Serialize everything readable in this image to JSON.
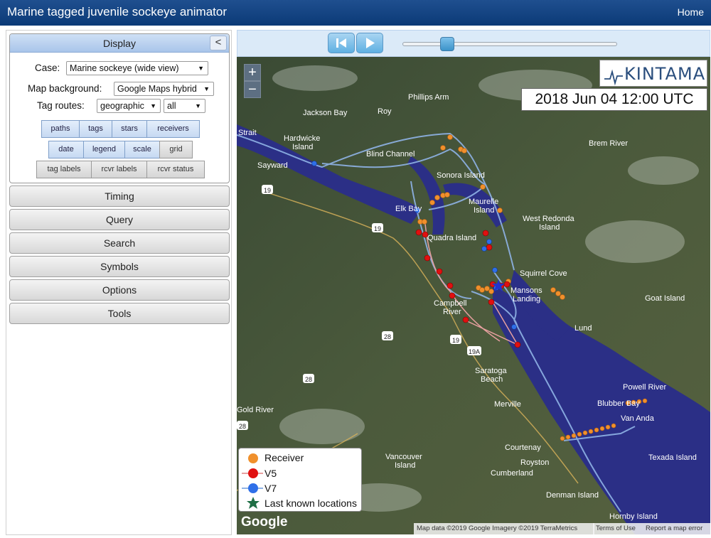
{
  "header": {
    "title": "Marine tagged juvenile sockeye animator",
    "home_label": "Home"
  },
  "display": {
    "title": "Display",
    "collapse_label": "<",
    "case_label": "Case:",
    "case_value": "Marine sockeye (wide view)",
    "map_bg_label": "Map background:",
    "map_bg_value": "Google Maps hybrid",
    "routes_label": "Tag routes:",
    "routes_value": "geographic",
    "routes_filter": "all",
    "toggles_row1": [
      "paths",
      "tags",
      "stars",
      "receivers"
    ],
    "toggles_row2": [
      "date",
      "legend",
      "scale",
      "grid"
    ],
    "toggles_row3": [
      "tag labels",
      "rcvr labels",
      "rcvr status"
    ]
  },
  "sections": [
    "Timing",
    "Query",
    "Search",
    "Symbols",
    "Options",
    "Tools"
  ],
  "playback": {
    "slider_fraction": 0.21
  },
  "map": {
    "zoom_in": "+",
    "zoom_out": "−",
    "logo": "KINTAMA",
    "date": "2018 Jun 04 12:00 UTC",
    "google": "Google",
    "attribution": [
      "Map data ©2019 Google Imagery ©2019 TerraMetrics",
      "Terms of Use",
      "Report a map error"
    ],
    "labels": [
      "Phillips Arm",
      "Jackson Bay",
      "Roy",
      "Hardwicke",
      "Island",
      "Blind Channel",
      "Sayward",
      "Sonora Island",
      "Brem River",
      "Maurelle",
      "Island",
      "Elk Bay",
      "West Redonda",
      "Island",
      "Quadra Island",
      "Squirrel Cove",
      "Mansons",
      "Landing",
      "Campbell",
      "River",
      "Goat Island",
      "Lund",
      "Saratoga",
      "Beach",
      "Merville",
      "Powell River",
      "Blubber Bay",
      "Van Anda",
      "Gold River",
      "Courtenay",
      "Vancouver",
      "Island",
      "Royston",
      "Texada Island",
      "Cumberland",
      "Denman Island",
      "Hornby Island",
      "Strait"
    ],
    "roads": [
      "19",
      "19",
      "28",
      "19",
      "19A",
      "28",
      "28"
    ]
  },
  "legend": {
    "items": [
      {
        "label": "Receiver",
        "color": "#f0902c"
      },
      {
        "label": "V5",
        "color": "#e01010"
      },
      {
        "label": "V7",
        "color": "#2f6fe8"
      },
      {
        "label": "Last known locations",
        "color": "#1f6f45"
      }
    ]
  },
  "colors": {
    "header": "#0b3a77",
    "receiver": "#f0902c",
    "v5": "#e01010",
    "v7": "#2f6fe8",
    "route": "#8fb3e6",
    "water": "#2b2f86"
  }
}
